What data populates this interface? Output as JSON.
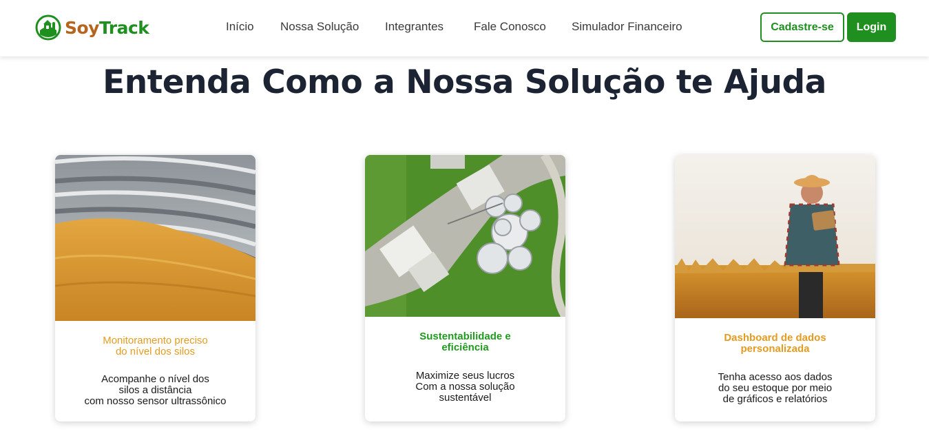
{
  "brand": {
    "name_part1": "Soy",
    "name_part2": "Track"
  },
  "nav": {
    "links": [
      "Início",
      "Nossa Solução",
      "Integrantes",
      "Fale Conosco",
      "Simulador Financeiro"
    ],
    "signup_label": "Cadastre-se",
    "login_label": "Login"
  },
  "main": {
    "title": "Entenda Como a Nossa Solução te Ajuda",
    "cards": [
      {
        "title_lines": [
          "Monitoramento preciso",
          "do nível dos silos"
        ],
        "desc_lines": [
          "Acompanhe o nível dos",
          "silos a distância",
          "com nosso sensor ultrassônico"
        ],
        "title_color": "#e49b1f"
      },
      {
        "title_lines": [
          "Sustentabilidade e",
          "eficiência"
        ],
        "desc_lines": [
          "Maximize seus lucros",
          "Com a nossa solução",
          "sustentável"
        ],
        "title_color": "#1f9a1f"
      },
      {
        "title_lines": [
          "Dashboard de dados",
          "personalizada"
        ],
        "desc_lines": [
          "Tenha acesso aos dados",
          "do seu estoque por meio",
          "de gráficos e relatórios"
        ],
        "title_color": "#e49b1f"
      }
    ]
  },
  "colors": {
    "brand_green": "#1f8f1f",
    "brand_brown": "#b5651d",
    "title_dark": "#1c2433"
  }
}
